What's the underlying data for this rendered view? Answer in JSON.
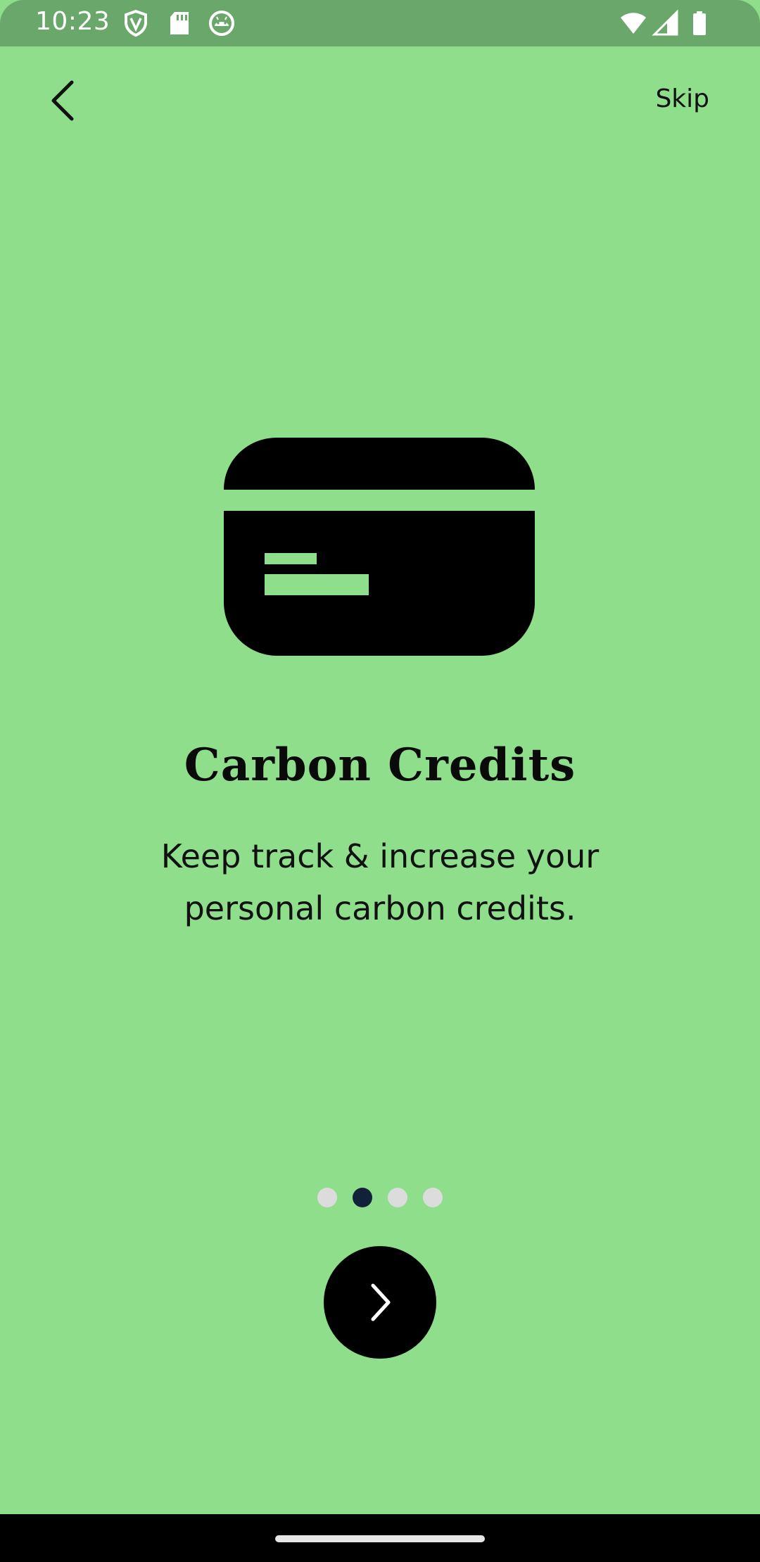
{
  "status_bar": {
    "time": "10:23",
    "left_icons": [
      "shield-icon",
      "sd-card-icon",
      "android-debug-icon"
    ],
    "right_icons": [
      "wifi-icon",
      "signal-icon",
      "battery-icon"
    ],
    "background_color": "#6aa76a"
  },
  "nav": {
    "back_icon": "chevron-left-icon",
    "skip_label": "Skip"
  },
  "onboarding": {
    "illustration_icon": "credit-card-icon",
    "title": "Carbon Credits",
    "subtitle": "Keep track & increase your personal carbon credits.",
    "page_indicator": {
      "total": 4,
      "active_index": 1
    },
    "next_icon": "chevron-right-icon"
  },
  "colors": {
    "background": "#8fde8c",
    "accent_dark": "#12213a",
    "inactive_dot": "#dcdcdc",
    "button": "#000000"
  }
}
